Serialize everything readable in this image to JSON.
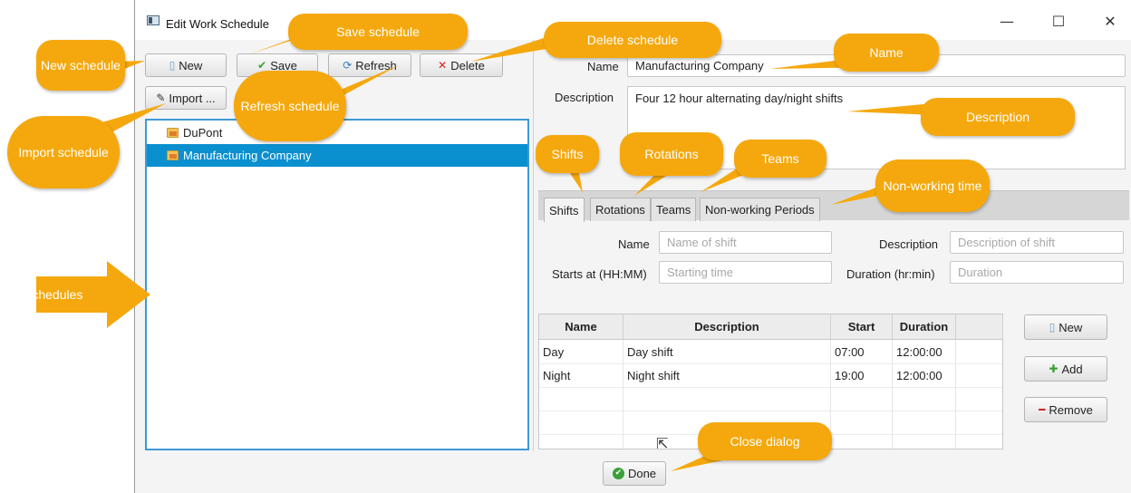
{
  "window": {
    "title": "Edit Work Schedule",
    "controls": {
      "minimize": "—",
      "maximize": "☐",
      "close": "✕"
    }
  },
  "toolbar": {
    "new": "New",
    "save": "Save",
    "refresh": "Refresh",
    "delete": "Delete",
    "import": "Import ..."
  },
  "schedules": [
    {
      "label": "DuPont",
      "selected": false
    },
    {
      "label": "Manufacturing Company",
      "selected": true
    }
  ],
  "form": {
    "name_label": "Name",
    "name_value": "Manufacturing Company",
    "description_label": "Description",
    "description_value": "Four 12 hour alternating day/night shifts"
  },
  "tabs": [
    "Shifts",
    "Rotations",
    "Teams",
    "Non-working Periods"
  ],
  "shift_form": {
    "name_label": "Name",
    "name_placeholder": "Name of shift",
    "description_label": "Description",
    "description_placeholder": "Description of shift",
    "starts_label": "Starts at (HH:MM)",
    "starts_placeholder": "Starting time",
    "duration_label": "Duration (hr:min)",
    "duration_placeholder": "Duration"
  },
  "shift_table": {
    "columns": [
      "Name",
      "Description",
      "Start",
      "Duration"
    ],
    "rows": [
      [
        "Day",
        "Day shift",
        "07:00",
        "12:00:00"
      ],
      [
        "Night",
        "Night shift",
        "19:00",
        "12:00:00"
      ]
    ]
  },
  "shift_buttons": {
    "new": "New",
    "add": "Add",
    "remove": "Remove"
  },
  "done": "Done",
  "callouts": {
    "new": "New schedule",
    "save": "Save schedule",
    "delete": "Delete schedule",
    "name": "Name",
    "refresh": "Refresh schedule",
    "import": "Import schedule",
    "description": "Description",
    "shifts": "Shifts",
    "rotations": "Rotations",
    "teams": "Teams",
    "nonworking": "Non-working time",
    "schedules": "Schedules",
    "close": "Close dialog"
  },
  "colors": {
    "callout": "#f5a80d",
    "selection": "#0a8fcf",
    "focus_border": "#3c9ad6"
  }
}
